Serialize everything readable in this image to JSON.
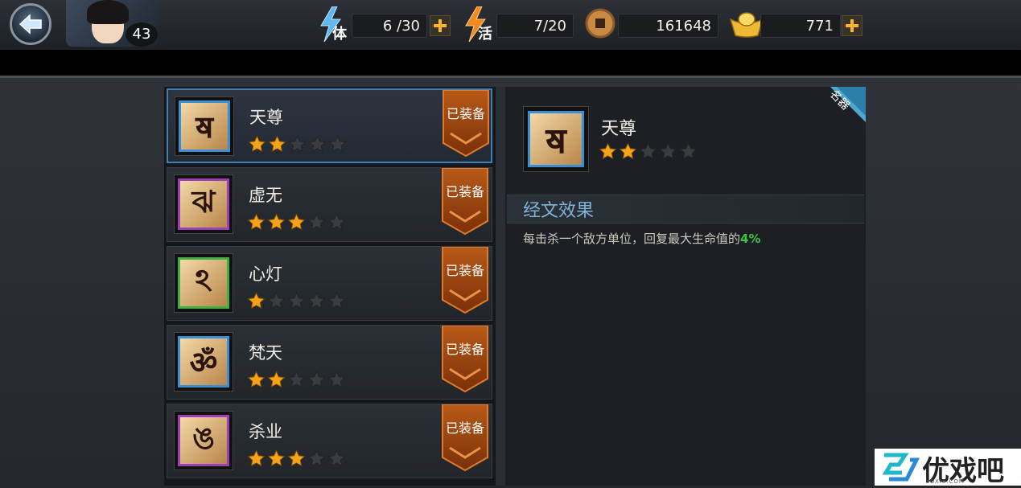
{
  "topbar": {
    "level": "43",
    "stamina": {
      "char": "体",
      "value": "6 /30"
    },
    "vigor": {
      "char": "活",
      "value": "7/20"
    },
    "coins": "161648",
    "ingots": "771"
  },
  "items": [
    {
      "name": "天尊",
      "stars": 2,
      "rarity": "blue",
      "glyph": "ॺ",
      "tag": "已装备",
      "selected": true
    },
    {
      "name": "虚无",
      "stars": 3,
      "rarity": "purple",
      "glyph": "ঝ",
      "tag": "已装备",
      "selected": false
    },
    {
      "name": "心灯",
      "stars": 1,
      "rarity": "green",
      "glyph": "ঽ",
      "tag": "已装备",
      "selected": false
    },
    {
      "name": "梵天",
      "stars": 2,
      "rarity": "blue",
      "glyph": "ॐ",
      "tag": "已装备",
      "selected": false
    },
    {
      "name": "杀业",
      "stars": 3,
      "rarity": "purple",
      "glyph": "ঙ",
      "tag": "已装备",
      "selected": false
    }
  ],
  "detail": {
    "name": "天尊",
    "stars": 2,
    "ribbon": "名器",
    "effect_title": "经文效果",
    "effect_desc": "每击杀一个敌方单位，回复最大生命值的",
    "effect_pct": "4%"
  },
  "watermark": {
    "text": "优戏吧",
    "sub": "YOXI8.COM"
  },
  "colors": {
    "star_on": "#f6a31c",
    "star_off": "#3a3c40",
    "accent_blue": "#3c7fb3",
    "effect_green": "#3ec43e"
  }
}
